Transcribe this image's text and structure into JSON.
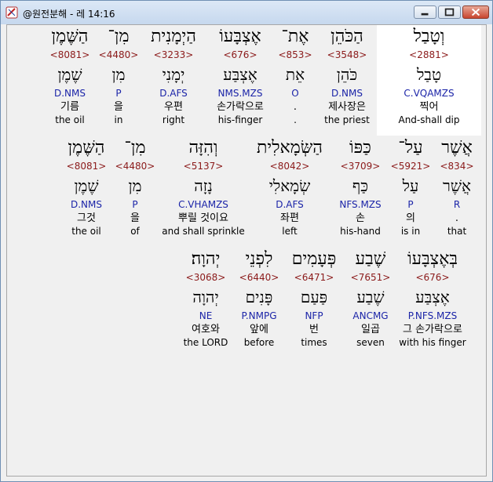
{
  "window": {
    "title": "@원전분해 - 레 14:16",
    "minimize_label": "minimize",
    "maximize_label": "maximize",
    "close_label": "close"
  },
  "rows": [
    {
      "words": [
        {
          "heb": "וְטָבַל",
          "strong": "<2881>",
          "lemma": "טָבַל",
          "morph": "C.VQAMZS",
          "kor": "찍어",
          "eng": "And-shall dip",
          "selected": true
        },
        {
          "heb": "הַכֹּהֵן",
          "strong": "<3548>",
          "lemma": "כֹּהֵן",
          "morph": "D.NMS",
          "kor": "제사장은",
          "eng": "the priest"
        },
        {
          "heb": "אֶת־",
          "strong": "<853>",
          "lemma": "אֵת",
          "morph": "O",
          "kor": ".",
          "eng": "."
        },
        {
          "heb": "אֶצְבָּעוֹ",
          "strong": "<676>",
          "lemma": "אֶצְבַּע",
          "morph": "NMS.MZS",
          "kor": "손가락으로",
          "eng": "his-finger"
        },
        {
          "heb": "הַיְמָנִית",
          "strong": "<3233>",
          "lemma": "יְמָנִי",
          "morph": "D.AFS",
          "kor": "우편",
          "eng": "right"
        },
        {
          "heb": "מִן־",
          "strong": "<4480>",
          "lemma": "מִן",
          "morph": "P",
          "kor": "을",
          "eng": "in"
        },
        {
          "heb": "הַשֶּׁמֶן",
          "strong": "<8081>",
          "lemma": "שֶׁמֶן",
          "morph": "D.NMS",
          "kor": "기름",
          "eng": "the oil"
        }
      ]
    },
    {
      "words": [
        {
          "heb": "אֲשֶׁר",
          "strong": "<834>",
          "lemma": "אֲשֶׁר",
          "morph": "R",
          "kor": ".",
          "eng": "that"
        },
        {
          "heb": "עַל־",
          "strong": "<5921>",
          "lemma": "עַל",
          "morph": "P",
          "kor": "의",
          "eng": "is in"
        },
        {
          "heb": "כַּפּוֹ",
          "strong": "<3709>",
          "lemma": "כַּף",
          "morph": "NFS.MZS",
          "kor": "손",
          "eng": "his-hand"
        },
        {
          "heb": "הַשְּׂמָאלִית",
          "strong": "<8042>",
          "lemma": "שְׂמָאלִי",
          "morph": "D.AFS",
          "kor": "좌편",
          "eng": "left"
        },
        {
          "heb": "וְהִזָּה",
          "strong": "<5137>",
          "lemma": "נָזָה",
          "morph": "C.VHAMZS",
          "kor": "뿌릴 것이요",
          "eng": "and shall sprinkle"
        },
        {
          "heb": "מִן־",
          "strong": "<4480>",
          "lemma": "מִן",
          "morph": "P",
          "kor": "을",
          "eng": "of"
        },
        {
          "heb": "הַשֶּׁמֶן",
          "strong": "<8081>",
          "lemma": "שֶׁמֶן",
          "morph": "D.NMS",
          "kor": "그것",
          "eng": "the oil"
        }
      ]
    },
    {
      "words": [
        {
          "heb": "בְּאֶצְבָּעוֹ",
          "strong": "<676>",
          "lemma": "אֶצְבַּע",
          "morph": "P.NFS.MZS",
          "kor": "그 손가락으로",
          "eng": "with his finger"
        },
        {
          "heb": "שֶׁבַע",
          "strong": "<7651>",
          "lemma": "שֶׁבַע",
          "morph": "ANCMG",
          "kor": "일곱",
          "eng": "seven"
        },
        {
          "heb": "פְּעָמִים",
          "strong": "<6471>",
          "lemma": "פַּעַם",
          "morph": "NFP",
          "kor": "번",
          "eng": "times"
        },
        {
          "heb": "לִפְנֵי",
          "strong": "<6440>",
          "lemma": "פָּנִים",
          "morph": "P.NMPG",
          "kor": "앞에",
          "eng": "before"
        },
        {
          "heb": "יְהוָה׃",
          "strong": "<3068>",
          "lemma": "יְהוָה",
          "morph": "NE",
          "kor": "여호와",
          "eng": "the LORD"
        }
      ]
    }
  ]
}
